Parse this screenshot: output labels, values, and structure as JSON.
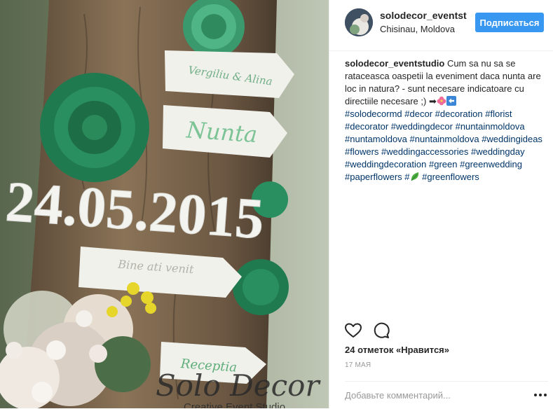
{
  "photo": {
    "date_sign": "24.05.2015",
    "signs": [
      "Vergiliu & Alina",
      "Nunta",
      "Bine ati venit",
      "Receptia"
    ],
    "watermark_title": "Solo Decor",
    "watermark_subtitle": "Creative Event Studio"
  },
  "header": {
    "username": "solodecor_eventst",
    "location": "Chisinau, Moldova",
    "follow_label": "Подписаться"
  },
  "caption": {
    "username": "solodecor_eventstudio",
    "text": "Cum sa nu sa se rataceasca oaspetii la eveniment daca nunta are loc in natura? - sunt necesare indicatoare cu directiile necesare ;) ➡",
    "emoji": [
      "hibiscus-flower",
      "left-arrow",
      "leaf"
    ],
    "hashtags_a": [
      "#solodecormd",
      "#decor",
      "#decoration",
      "#florist",
      "#decorator",
      "#weddingdecor",
      "#nuntainmoldova",
      "#nuntamoldova",
      "#nuntainmoldova",
      "#weddingideas",
      "#flowers",
      "#weddingaccessories",
      "#weddingday",
      "#weddingdecoration",
      "#green",
      "#greenwedding",
      "#paperflowers",
      "#"
    ],
    "hashtags_b": [
      "#greenflowers"
    ]
  },
  "actions": {
    "like_icon": "heart-icon",
    "comment_icon": "comment-icon"
  },
  "likes": "24 отметок «Нравится»",
  "date": "17 МАЯ",
  "comment": {
    "placeholder": "Добавьте комментарий...",
    "more_icon": "more-options-icon"
  }
}
